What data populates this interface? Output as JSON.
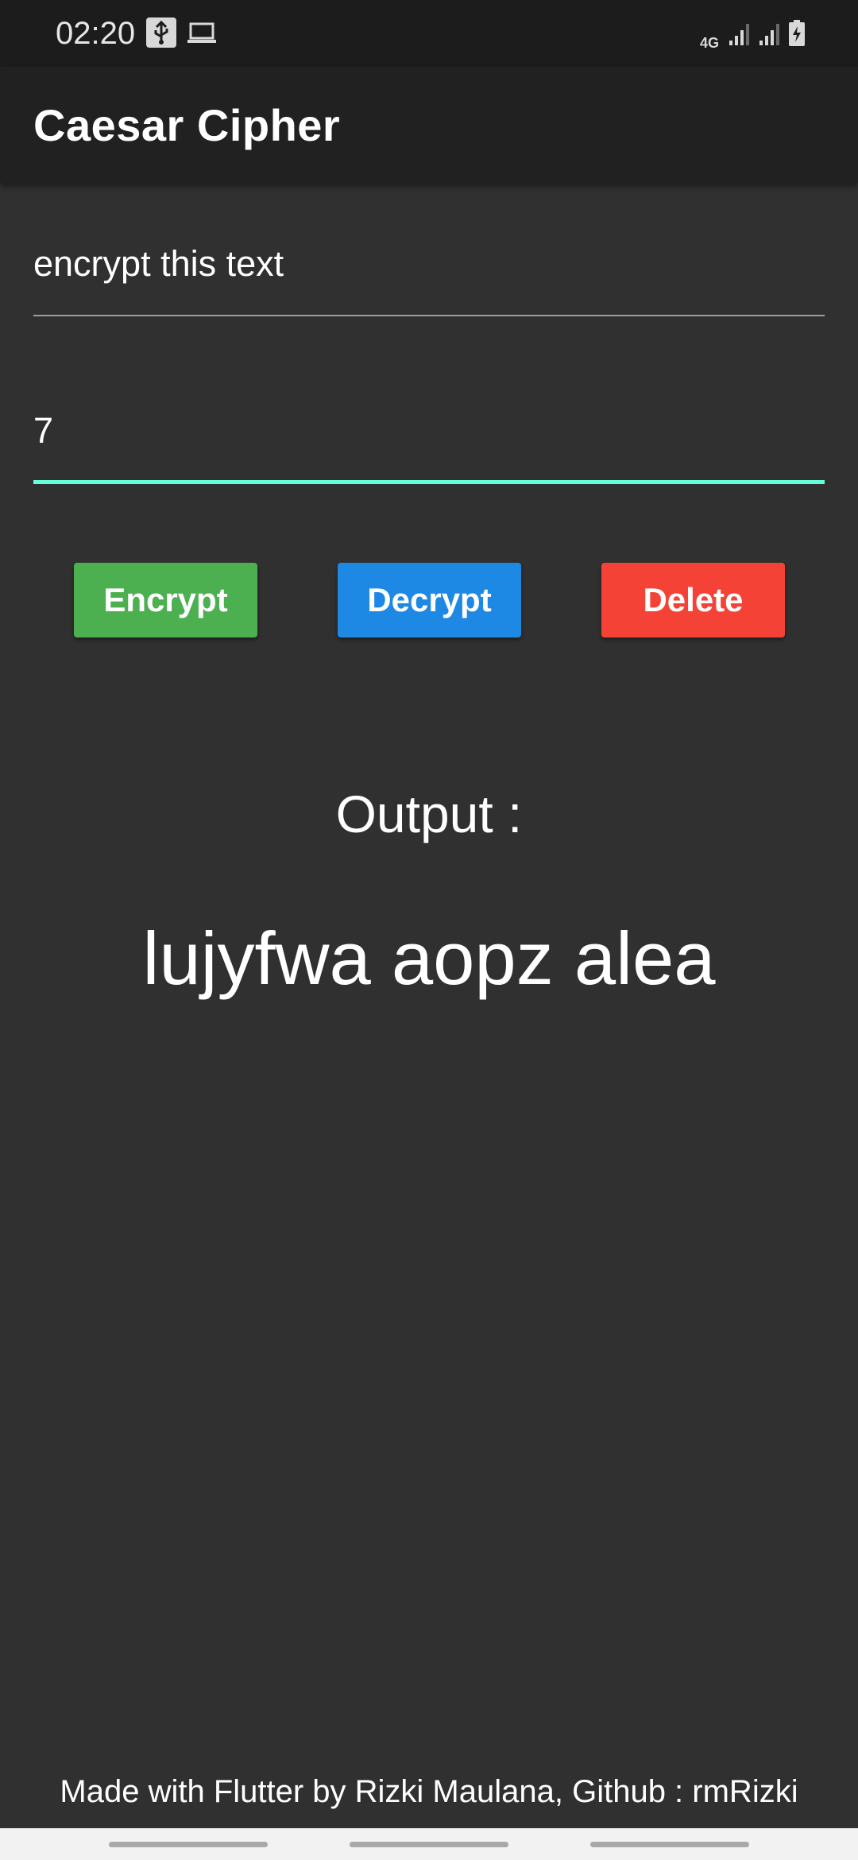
{
  "status_bar": {
    "time": "02:20",
    "network": "4G",
    "icons": [
      "usb-icon",
      "laptop-icon",
      "signal-icon",
      "signal-icon",
      "battery-charging-icon"
    ]
  },
  "app_bar": {
    "title": "Caesar Cipher"
  },
  "form": {
    "text_input_value": "encrypt this text",
    "shift_input_value": "7"
  },
  "buttons": {
    "encrypt_label": "Encrypt",
    "decrypt_label": "Decrypt",
    "delete_label": "Delete"
  },
  "output": {
    "label": "Output :",
    "value": "lujyfwa aopz alea"
  },
  "footer": {
    "text": "Made with Flutter by Rizki Maulana, Github : rmRizki"
  },
  "colors": {
    "background": "#303030",
    "app_bar": "#212121",
    "focused_underline": "#64ffda",
    "encrypt": "#4caf50",
    "decrypt": "#1e88e5",
    "delete": "#f44336"
  }
}
